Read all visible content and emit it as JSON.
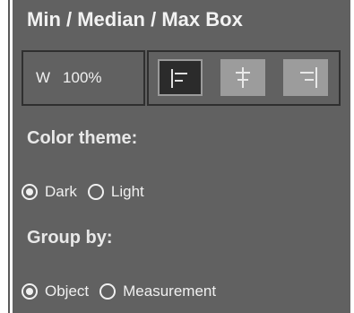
{
  "panel": {
    "title": "Min / Median / Max Box",
    "width": {
      "label": "W",
      "value": "100%"
    },
    "alignment": {
      "options": [
        "align-left",
        "align-center",
        "align-right"
      ],
      "selected": "align-left"
    },
    "color_theme": {
      "label": "Color theme:",
      "options": [
        "Dark",
        "Light"
      ],
      "selected": "Dark"
    },
    "group_by": {
      "label": "Group by:",
      "options": [
        "Object",
        "Measurement"
      ],
      "selected": "Object"
    }
  },
  "colors": {
    "panel_bg": "#616161",
    "text": "#f0f0f0",
    "active_button_bg": "#2b2b2b",
    "inactive_button_bg": "#9c9c9c"
  }
}
